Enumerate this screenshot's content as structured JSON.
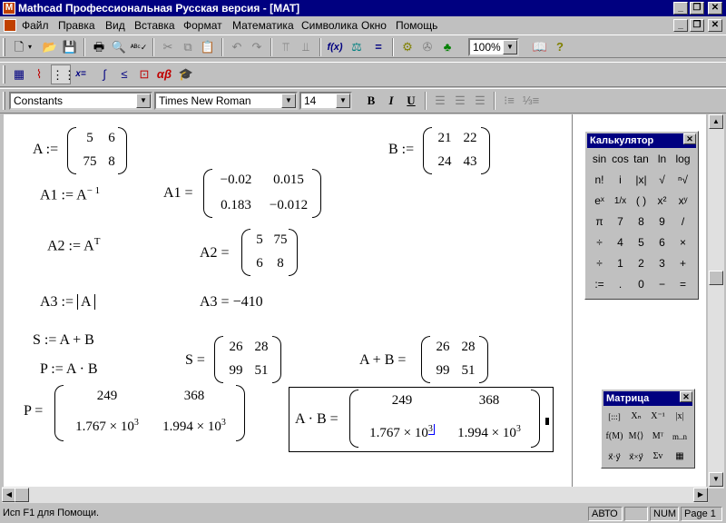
{
  "window": {
    "title": "Mathcad Профессиональная Русская версия - [MAT]",
    "controls": [
      "_",
      "❐",
      "✕"
    ]
  },
  "menu": [
    "Файл",
    "Правка",
    "Вид",
    "Вставка",
    "Формат",
    "Математика",
    "Символика",
    "Окно",
    "Помощь"
  ],
  "toolbar": {
    "zoom": "100%"
  },
  "format_bar": {
    "style": "Constants",
    "font": "Times New Roman",
    "size": "14",
    "bold": "B",
    "italic": "I",
    "underline": "U"
  },
  "worksheet": {
    "A_def": "A :=",
    "A": [
      [
        "5",
        "6"
      ],
      [
        "75",
        "8"
      ]
    ],
    "B_def": "B :=",
    "B": [
      [
        "21",
        "22"
      ],
      [
        "24",
        "43"
      ]
    ],
    "A1_def_lhs": "A1 := A",
    "A1_def_exp": "− 1",
    "A1_res": "A1 =",
    "A1": [
      [
        "−0.02",
        "0.015"
      ],
      [
        "0.183",
        "−0.012"
      ]
    ],
    "A2_def_lhs": "A2 := A",
    "A2_def_exp": "T",
    "A2_res": "A2 =",
    "A2": [
      [
        "5",
        "75"
      ],
      [
        "6",
        "8"
      ]
    ],
    "A3_def": "A3 := ",
    "A3_inner": "A",
    "A3_res": "A3 = −410",
    "S_def": "S := A + B",
    "P_def": "P := A · B",
    "S_res": "S =",
    "S": [
      [
        "26",
        "28"
      ],
      [
        "99",
        "51"
      ]
    ],
    "ApB_res": "A + B =",
    "ApB": [
      [
        "26",
        "28"
      ],
      [
        "99",
        "51"
      ]
    ],
    "P_res": "P =",
    "P": [
      [
        "249",
        "368"
      ],
      [
        "1.767 × 10",
        "1.994 × 10"
      ]
    ],
    "exp3": "3",
    "AxB_res": "A · B =",
    "AxB": [
      [
        "249",
        "368"
      ],
      [
        "1.767 × 10",
        "1.994 × 10"
      ]
    ]
  },
  "calculator": {
    "title": "Калькулятор",
    "rows": [
      [
        "sin",
        "cos",
        "tan",
        "ln",
        "log"
      ],
      [
        "n!",
        "i",
        "|x|",
        "√",
        "ⁿ√"
      ],
      [
        "eˣ",
        "1/x",
        "( )",
        "x²",
        "xʸ"
      ],
      [
        "π",
        "7",
        "8",
        "9",
        "/"
      ],
      [
        "÷",
        "4",
        "5",
        "6",
        "×"
      ],
      [
        "÷",
        "1",
        "2",
        "3",
        "+"
      ],
      [
        ":=",
        ".",
        "0",
        "−",
        "="
      ]
    ]
  },
  "matrix_palette": {
    "title": "Матрица",
    "rows": [
      [
        "[:::]",
        "Xₙ",
        "X⁻¹",
        "|x|"
      ],
      [
        "f(M)",
        "M⟨⟩",
        "Mᵀ",
        "m..n"
      ],
      [
        "x⃗·y⃗",
        "x⃗×y⃗",
        "Σv",
        "▦"
      ]
    ]
  },
  "status": {
    "help": "Исп F1 для Помощи.",
    "mode": "АВТО",
    "num": "NUM",
    "page": "Page 1"
  }
}
